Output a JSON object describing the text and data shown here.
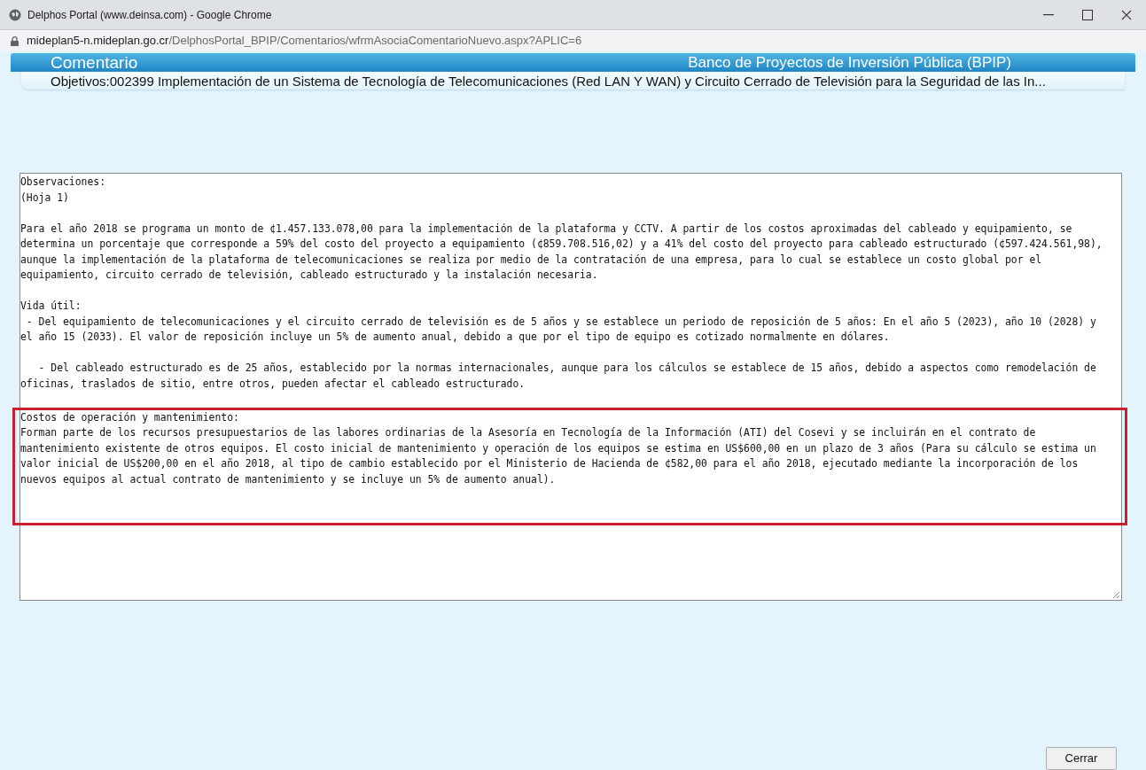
{
  "browser": {
    "title": "Delphos Portal (www.deinsa.com) - Google Chrome",
    "url_host": "mideplan5-n.mideplan.go.cr",
    "url_path": "/DelphosPortal_BPIP/Comentarios/wfrmAsociaComentarioNuevo.aspx?APLIC=6"
  },
  "header": {
    "title": "Comentario",
    "brand": "Banco de Proyectos de Inversión Pública (BPIP)",
    "objective": "Objetivos:002399 Implementación de un Sistema de Tecnología de Telecomunicaciones (Red LAN Y WAN) y Circuito Cerrado de Televisión para la Seguridad de las In..."
  },
  "comment_sections": [
    {
      "highlighted": false,
      "lines": [
        "Observaciones:",
        "(Hoja 1)"
      ]
    },
    {
      "highlighted": false,
      "lines": [
        "Para el año 2018 se programa un monto de ¢1.457.133.078,00 para la implementación de la plataforma y CCTV. A partir de los costos aproximadas del cableado y equipamiento, se",
        "determina un porcentaje que corresponde a 59% del costo del proyecto a equipamiento (¢859.708.516,02) y a 41% del costo del proyecto para cableado estructurado (¢597.424.561,98),",
        "aunque la implementación de la plataforma de telecomunicaciones se realiza por medio de la contratación de una empresa, para lo cual se establece un costo global por el",
        "equipamiento, circuito cerrado de televisión, cableado estructurado y la instalación necesaria."
      ]
    },
    {
      "highlighted": false,
      "lines": [
        "Vida útil:",
        " - Del equipamiento de telecomunicaciones y el circuito cerrado de televisión es de 5 años y se establece un periodo de reposición de 5 años: En el año 5 (2023), año 10 (2028) y",
        "el año 15 (2033). El valor de reposición incluye un 5% de aumento anual, debido a que por el tipo de equipo es cotizado normalmente en dólares."
      ]
    },
    {
      "highlighted": false,
      "lines": [
        "   - Del cableado estructurado es de 25 años, establecido por la normas internacionales, aunque para los cálculos se establece de 15 años, debido a aspectos como remodelación de",
        "oficinas, traslados de sitio, entre otros, pueden afectar el cableado estructurado."
      ]
    },
    {
      "highlighted": true,
      "lines": [
        "Costos de operación y mantenimiento:",
        "Forman parte de los recursos presupuestarios de las labores ordinarias de la Asesoría en Tecnología de la Información (ATI) del Cosevi y se incluirán en el contrato de",
        "mantenimiento existente de otros equipos. El costo inicial de mantenimiento y operación de los equipos se estima en US$600,00 en un plazo de 3 años (Para su cálculo se estima un",
        "valor inicial de US$200,00 en el año 2018, al tipo de cambio establecido por el Ministerio de Hacienda de ¢582,00 para el año 2018, ejecutado mediante la incorporación de los",
        "nuevos equipos al actual contrato de mantenimiento y se incluye un 5% de aumento anual)."
      ]
    }
  ],
  "close_button": "Cerrar"
}
